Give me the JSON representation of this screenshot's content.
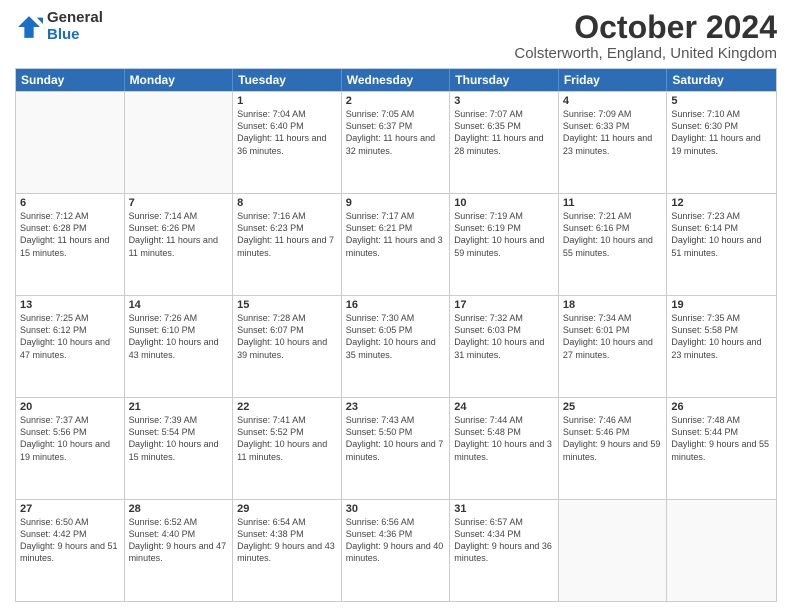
{
  "logo": {
    "general": "General",
    "blue": "Blue"
  },
  "title": "October 2024",
  "subtitle": "Colsterworth, England, United Kingdom",
  "header_days": [
    "Sunday",
    "Monday",
    "Tuesday",
    "Wednesday",
    "Thursday",
    "Friday",
    "Saturday"
  ],
  "weeks": [
    [
      {
        "day": "",
        "sunrise": "",
        "sunset": "",
        "daylight": "",
        "empty": true
      },
      {
        "day": "",
        "sunrise": "",
        "sunset": "",
        "daylight": "",
        "empty": true
      },
      {
        "day": "1",
        "sunrise": "Sunrise: 7:04 AM",
        "sunset": "Sunset: 6:40 PM",
        "daylight": "Daylight: 11 hours and 36 minutes.",
        "empty": false
      },
      {
        "day": "2",
        "sunrise": "Sunrise: 7:05 AM",
        "sunset": "Sunset: 6:37 PM",
        "daylight": "Daylight: 11 hours and 32 minutes.",
        "empty": false
      },
      {
        "day": "3",
        "sunrise": "Sunrise: 7:07 AM",
        "sunset": "Sunset: 6:35 PM",
        "daylight": "Daylight: 11 hours and 28 minutes.",
        "empty": false
      },
      {
        "day": "4",
        "sunrise": "Sunrise: 7:09 AM",
        "sunset": "Sunset: 6:33 PM",
        "daylight": "Daylight: 11 hours and 23 minutes.",
        "empty": false
      },
      {
        "day": "5",
        "sunrise": "Sunrise: 7:10 AM",
        "sunset": "Sunset: 6:30 PM",
        "daylight": "Daylight: 11 hours and 19 minutes.",
        "empty": false
      }
    ],
    [
      {
        "day": "6",
        "sunrise": "Sunrise: 7:12 AM",
        "sunset": "Sunset: 6:28 PM",
        "daylight": "Daylight: 11 hours and 15 minutes.",
        "empty": false
      },
      {
        "day": "7",
        "sunrise": "Sunrise: 7:14 AM",
        "sunset": "Sunset: 6:26 PM",
        "daylight": "Daylight: 11 hours and 11 minutes.",
        "empty": false
      },
      {
        "day": "8",
        "sunrise": "Sunrise: 7:16 AM",
        "sunset": "Sunset: 6:23 PM",
        "daylight": "Daylight: 11 hours and 7 minutes.",
        "empty": false
      },
      {
        "day": "9",
        "sunrise": "Sunrise: 7:17 AM",
        "sunset": "Sunset: 6:21 PM",
        "daylight": "Daylight: 11 hours and 3 minutes.",
        "empty": false
      },
      {
        "day": "10",
        "sunrise": "Sunrise: 7:19 AM",
        "sunset": "Sunset: 6:19 PM",
        "daylight": "Daylight: 10 hours and 59 minutes.",
        "empty": false
      },
      {
        "day": "11",
        "sunrise": "Sunrise: 7:21 AM",
        "sunset": "Sunset: 6:16 PM",
        "daylight": "Daylight: 10 hours and 55 minutes.",
        "empty": false
      },
      {
        "day": "12",
        "sunrise": "Sunrise: 7:23 AM",
        "sunset": "Sunset: 6:14 PM",
        "daylight": "Daylight: 10 hours and 51 minutes.",
        "empty": false
      }
    ],
    [
      {
        "day": "13",
        "sunrise": "Sunrise: 7:25 AM",
        "sunset": "Sunset: 6:12 PM",
        "daylight": "Daylight: 10 hours and 47 minutes.",
        "empty": false
      },
      {
        "day": "14",
        "sunrise": "Sunrise: 7:26 AM",
        "sunset": "Sunset: 6:10 PM",
        "daylight": "Daylight: 10 hours and 43 minutes.",
        "empty": false
      },
      {
        "day": "15",
        "sunrise": "Sunrise: 7:28 AM",
        "sunset": "Sunset: 6:07 PM",
        "daylight": "Daylight: 10 hours and 39 minutes.",
        "empty": false
      },
      {
        "day": "16",
        "sunrise": "Sunrise: 7:30 AM",
        "sunset": "Sunset: 6:05 PM",
        "daylight": "Daylight: 10 hours and 35 minutes.",
        "empty": false
      },
      {
        "day": "17",
        "sunrise": "Sunrise: 7:32 AM",
        "sunset": "Sunset: 6:03 PM",
        "daylight": "Daylight: 10 hours and 31 minutes.",
        "empty": false
      },
      {
        "day": "18",
        "sunrise": "Sunrise: 7:34 AM",
        "sunset": "Sunset: 6:01 PM",
        "daylight": "Daylight: 10 hours and 27 minutes.",
        "empty": false
      },
      {
        "day": "19",
        "sunrise": "Sunrise: 7:35 AM",
        "sunset": "Sunset: 5:58 PM",
        "daylight": "Daylight: 10 hours and 23 minutes.",
        "empty": false
      }
    ],
    [
      {
        "day": "20",
        "sunrise": "Sunrise: 7:37 AM",
        "sunset": "Sunset: 5:56 PM",
        "daylight": "Daylight: 10 hours and 19 minutes.",
        "empty": false
      },
      {
        "day": "21",
        "sunrise": "Sunrise: 7:39 AM",
        "sunset": "Sunset: 5:54 PM",
        "daylight": "Daylight: 10 hours and 15 minutes.",
        "empty": false
      },
      {
        "day": "22",
        "sunrise": "Sunrise: 7:41 AM",
        "sunset": "Sunset: 5:52 PM",
        "daylight": "Daylight: 10 hours and 11 minutes.",
        "empty": false
      },
      {
        "day": "23",
        "sunrise": "Sunrise: 7:43 AM",
        "sunset": "Sunset: 5:50 PM",
        "daylight": "Daylight: 10 hours and 7 minutes.",
        "empty": false
      },
      {
        "day": "24",
        "sunrise": "Sunrise: 7:44 AM",
        "sunset": "Sunset: 5:48 PM",
        "daylight": "Daylight: 10 hours and 3 minutes.",
        "empty": false
      },
      {
        "day": "25",
        "sunrise": "Sunrise: 7:46 AM",
        "sunset": "Sunset: 5:46 PM",
        "daylight": "Daylight: 9 hours and 59 minutes.",
        "empty": false
      },
      {
        "day": "26",
        "sunrise": "Sunrise: 7:48 AM",
        "sunset": "Sunset: 5:44 PM",
        "daylight": "Daylight: 9 hours and 55 minutes.",
        "empty": false
      }
    ],
    [
      {
        "day": "27",
        "sunrise": "Sunrise: 6:50 AM",
        "sunset": "Sunset: 4:42 PM",
        "daylight": "Daylight: 9 hours and 51 minutes.",
        "empty": false
      },
      {
        "day": "28",
        "sunrise": "Sunrise: 6:52 AM",
        "sunset": "Sunset: 4:40 PM",
        "daylight": "Daylight: 9 hours and 47 minutes.",
        "empty": false
      },
      {
        "day": "29",
        "sunrise": "Sunrise: 6:54 AM",
        "sunset": "Sunset: 4:38 PM",
        "daylight": "Daylight: 9 hours and 43 minutes.",
        "empty": false
      },
      {
        "day": "30",
        "sunrise": "Sunrise: 6:56 AM",
        "sunset": "Sunset: 4:36 PM",
        "daylight": "Daylight: 9 hours and 40 minutes.",
        "empty": false
      },
      {
        "day": "31",
        "sunrise": "Sunrise: 6:57 AM",
        "sunset": "Sunset: 4:34 PM",
        "daylight": "Daylight: 9 hours and 36 minutes.",
        "empty": false
      },
      {
        "day": "",
        "sunrise": "",
        "sunset": "",
        "daylight": "",
        "empty": true
      },
      {
        "day": "",
        "sunrise": "",
        "sunset": "",
        "daylight": "",
        "empty": true
      }
    ]
  ]
}
